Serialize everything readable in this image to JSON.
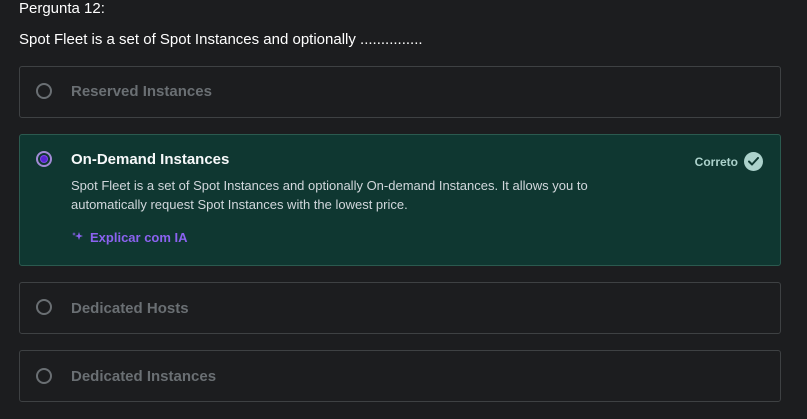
{
  "question": {
    "number": "Pergunta 12:",
    "text": "Spot Fleet is a set of Spot Instances and optionally ..............."
  },
  "options": [
    {
      "label": "Reserved Instances",
      "selected": false
    },
    {
      "label": "On-Demand Instances",
      "selected": true,
      "status": "Correto",
      "explanation": "Spot Fleet is a set of Spot Instances and optionally On-demand Instances. It allows you to automatically request Spot Instances with the lowest price.",
      "ai_link": "Explicar com IA"
    },
    {
      "label": "Dedicated Hosts",
      "selected": false
    },
    {
      "label": "Dedicated Instances",
      "selected": false
    }
  ],
  "colors": {
    "background": "#1c1d1f",
    "correct_bg": "#0f3731",
    "correct_accent": "#acd2cc",
    "ai_accent": "#8b62f0",
    "radio_selected": "#5624d0",
    "muted_text": "#6a6f73"
  },
  "icons": {
    "check": "check-circle-icon",
    "sparkle": "sparkle-icon"
  }
}
